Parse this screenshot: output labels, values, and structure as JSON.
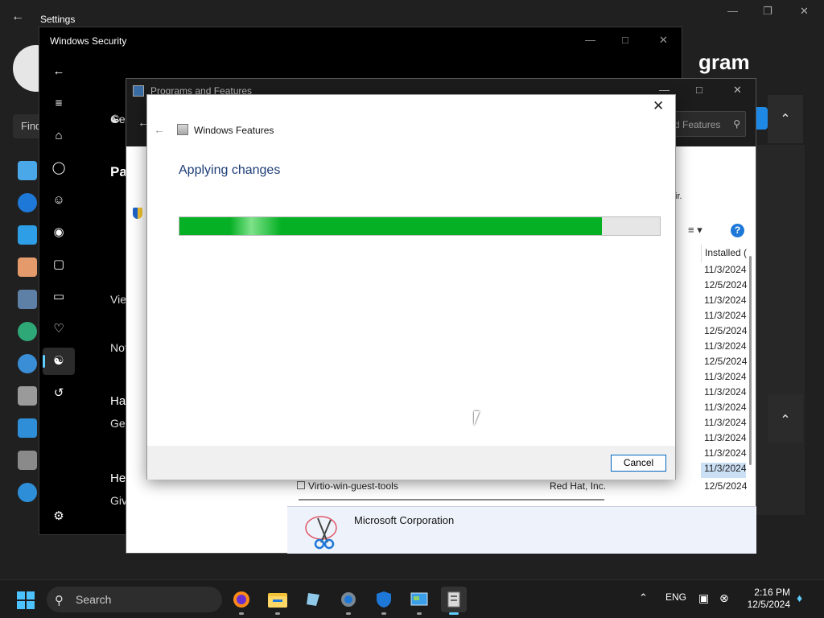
{
  "settings": {
    "title": "Settings",
    "search_placeholder": "Find",
    "headline": "gram"
  },
  "windows_security": {
    "title": "Windows Security",
    "content_lines": [
      "Ge",
      "Pa",
      "Vie",
      "Not",
      "Hav",
      "Ge",
      "He",
      "Giv"
    ]
  },
  "programs_features": {
    "title": "Programs and Features",
    "search_placeholder": "d Features",
    "partial_text": "ir.",
    "column_installed": "Installed (",
    "installed_dates": [
      "11/3/2024",
      "12/5/2024",
      "11/3/2024",
      "11/3/2024",
      "12/5/2024",
      "11/3/2024",
      "12/5/2024",
      "11/3/2024",
      "11/3/2024",
      "11/3/2024",
      "11/3/2024",
      "11/3/2024",
      "11/3/2024",
      "11/3/2024"
    ],
    "last_row": {
      "name": "Virtio-win-guest-tools",
      "publisher": "Red Hat, Inc.",
      "date": "12/5/2024"
    },
    "details_publisher": "Microsoft Corporation"
  },
  "windows_features": {
    "title": "Windows Features",
    "heading": "Applying changes",
    "progress_fraction": 0.88,
    "cancel_label": "Cancel"
  },
  "taskbar": {
    "search_label": "Search",
    "language": "ENG",
    "time": "2:16 PM",
    "date": "12/5/2024"
  },
  "colors": {
    "accent": "#60cdff",
    "progress_green": "#06b025",
    "heading_blue": "#1e3d78"
  }
}
